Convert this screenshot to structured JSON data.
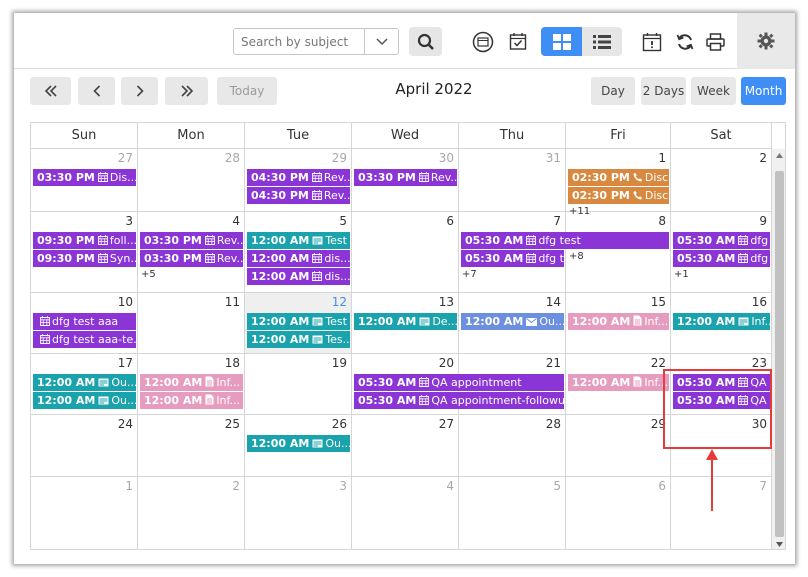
{
  "toolbar": {
    "search_placeholder": "Search by subject"
  },
  "nav": {
    "today_label": "Today",
    "title": "April 2022",
    "views": [
      {
        "label": "Day",
        "active": false
      },
      {
        "label": "2 Days",
        "active": false
      },
      {
        "label": "Week",
        "active": false
      },
      {
        "label": "Month",
        "active": true
      }
    ]
  },
  "weekdays": [
    "Sun",
    "Mon",
    "Tue",
    "Wed",
    "Thu",
    "Fri",
    "Sat"
  ],
  "weeks": [
    {
      "days": [
        {
          "num": "27",
          "muted": true
        },
        {
          "num": "28",
          "muted": true
        },
        {
          "num": "29",
          "muted": true
        },
        {
          "num": "30",
          "muted": true
        },
        {
          "num": "31",
          "muted": true
        },
        {
          "num": "1"
        },
        {
          "num": "2"
        }
      ]
    },
    {
      "days": [
        {
          "num": "3"
        },
        {
          "num": "4"
        },
        {
          "num": "5"
        },
        {
          "num": "6"
        },
        {
          "num": "7"
        },
        {
          "num": "8"
        },
        {
          "num": "9"
        }
      ]
    },
    {
      "days": [
        {
          "num": "10"
        },
        {
          "num": "11"
        },
        {
          "num": "12",
          "today": true
        },
        {
          "num": "13"
        },
        {
          "num": "14"
        },
        {
          "num": "15"
        },
        {
          "num": "16"
        }
      ]
    },
    {
      "days": [
        {
          "num": "17"
        },
        {
          "num": "18"
        },
        {
          "num": "19"
        },
        {
          "num": "20"
        },
        {
          "num": "21"
        },
        {
          "num": "22"
        },
        {
          "num": "23"
        }
      ]
    },
    {
      "days": [
        {
          "num": "24"
        },
        {
          "num": "25"
        },
        {
          "num": "26"
        },
        {
          "num": "27"
        },
        {
          "num": "28"
        },
        {
          "num": "29"
        },
        {
          "num": "30"
        }
      ]
    },
    {
      "days": [
        {
          "num": "1",
          "muted": true
        },
        {
          "num": "2",
          "muted": true
        },
        {
          "num": "3",
          "muted": true
        },
        {
          "num": "4",
          "muted": true
        },
        {
          "num": "5",
          "muted": true
        },
        {
          "num": "6",
          "muted": true
        },
        {
          "num": "7",
          "muted": true
        }
      ]
    }
  ],
  "events": [
    {
      "week": 0,
      "col": 0,
      "span": 1,
      "slot": 0,
      "time": "03:30 PM",
      "icon": "calendar",
      "title": "Dis...",
      "color": "purple"
    },
    {
      "week": 0,
      "col": 2,
      "span": 1,
      "slot": 0,
      "time": "04:30 PM",
      "icon": "calendar",
      "title": "Rev...",
      "color": "purple"
    },
    {
      "week": 0,
      "col": 2,
      "span": 1,
      "slot": 1,
      "time": "04:30 PM",
      "icon": "calendar",
      "title": "Rev...",
      "color": "purple"
    },
    {
      "week": 0,
      "col": 3,
      "span": 1,
      "slot": 0,
      "time": "03:30 PM",
      "icon": "calendar",
      "title": "Rev...",
      "color": "purple"
    },
    {
      "week": 0,
      "col": 5,
      "span": 1,
      "slot": 0,
      "time": "02:30 PM",
      "icon": "phone",
      "title": "Disc...",
      "color": "orange"
    },
    {
      "week": 0,
      "col": 5,
      "span": 1,
      "slot": 1,
      "time": "02:30 PM",
      "icon": "phone",
      "title": "Disc...",
      "color": "orange"
    },
    {
      "week": 1,
      "col": 0,
      "span": 1,
      "slot": 0,
      "time": "09:30 PM",
      "icon": "calendar",
      "title": "foll...",
      "color": "purple"
    },
    {
      "week": 1,
      "col": 0,
      "span": 1,
      "slot": 1,
      "time": "09:30 PM",
      "icon": "calendar",
      "title": "Syn...",
      "color": "purple"
    },
    {
      "week": 1,
      "col": 1,
      "span": 1,
      "slot": 0,
      "time": "03:30 PM",
      "icon": "calendar",
      "title": "Rev...",
      "color": "purple"
    },
    {
      "week": 1,
      "col": 1,
      "span": 1,
      "slot": 1,
      "time": "03:30 PM",
      "icon": "calendar",
      "title": "Rev...",
      "color": "purple"
    },
    {
      "week": 1,
      "col": 2,
      "span": 1,
      "slot": 0,
      "time": "12:00 AM",
      "icon": "card",
      "title": "Test",
      "color": "teal"
    },
    {
      "week": 1,
      "col": 2,
      "span": 1,
      "slot": 1,
      "time": "12:00 AM",
      "icon": "calendar",
      "title": "dis...",
      "color": "purple"
    },
    {
      "week": 1,
      "col": 2,
      "span": 1,
      "slot": 2,
      "time": "12:00 AM",
      "icon": "calendar",
      "title": "dis...",
      "color": "purple"
    },
    {
      "week": 1,
      "col": 4,
      "span": 2,
      "slot": 0,
      "time": "05:30 AM",
      "icon": "calendar",
      "title": "dfg test",
      "color": "purple"
    },
    {
      "week": 1,
      "col": 4,
      "span": 1,
      "slot": 1,
      "time": "05:30 AM",
      "icon": "calendar",
      "title": "dfg test ..",
      "color": "purple"
    },
    {
      "week": 1,
      "col": 6,
      "span": 1,
      "slot": 0,
      "time": "05:30 AM",
      "icon": "calendar",
      "title": "dfg ...",
      "color": "purple"
    },
    {
      "week": 1,
      "col": 6,
      "span": 1,
      "slot": 1,
      "time": "05:30 AM",
      "icon": "calendar",
      "title": "dfg ...",
      "color": "purple"
    },
    {
      "week": 2,
      "col": 0,
      "span": 1,
      "slot": 0,
      "time": "",
      "icon": "calendar",
      "title": "dfg test aaa",
      "color": "purple"
    },
    {
      "week": 2,
      "col": 0,
      "span": 1,
      "slot": 1,
      "time": "",
      "icon": "calendar",
      "title": "dfg test aaa-te...",
      "color": "purple"
    },
    {
      "week": 2,
      "col": 2,
      "span": 1,
      "slot": 0,
      "time": "12:00 AM",
      "icon": "card",
      "title": "Test",
      "color": "teal"
    },
    {
      "week": 2,
      "col": 2,
      "span": 1,
      "slot": 1,
      "time": "12:00 AM",
      "icon": "card",
      "title": "Tes...",
      "color": "teal"
    },
    {
      "week": 2,
      "col": 3,
      "span": 1,
      "slot": 0,
      "time": "12:00 AM",
      "icon": "card",
      "title": "De...",
      "color": "teal"
    },
    {
      "week": 2,
      "col": 4,
      "span": 1,
      "slot": 0,
      "time": "12:00 AM",
      "icon": "mail",
      "title": "Ou...",
      "color": "lblue"
    },
    {
      "week": 2,
      "col": 5,
      "span": 1,
      "slot": 0,
      "time": "12:00 AM",
      "icon": "doc",
      "title": "Inf...",
      "color": "pink"
    },
    {
      "week": 2,
      "col": 6,
      "span": 1,
      "slot": 0,
      "time": "12:00 AM",
      "icon": "card",
      "title": "Inf...",
      "color": "teal"
    },
    {
      "week": 3,
      "col": 0,
      "span": 1,
      "slot": 0,
      "time": "12:00 AM",
      "icon": "card",
      "title": "Ou...",
      "color": "teal"
    },
    {
      "week": 3,
      "col": 0,
      "span": 1,
      "slot": 1,
      "time": "12:00 AM",
      "icon": "card",
      "title": "Ou...",
      "color": "teal"
    },
    {
      "week": 3,
      "col": 1,
      "span": 1,
      "slot": 0,
      "time": "12:00 AM",
      "icon": "doc",
      "title": "Inf...",
      "color": "pink"
    },
    {
      "week": 3,
      "col": 1,
      "span": 1,
      "slot": 1,
      "time": "12:00 AM",
      "icon": "doc",
      "title": "Inf...",
      "color": "pink"
    },
    {
      "week": 3,
      "col": 3,
      "span": 2,
      "slot": 0,
      "time": "05:30 AM",
      "icon": "calendar",
      "title": "QA appointment",
      "color": "purple"
    },
    {
      "week": 3,
      "col": 3,
      "span": 2,
      "slot": 1,
      "time": "05:30 AM",
      "icon": "calendar",
      "title": "QA appointment-followup",
      "color": "purple"
    },
    {
      "week": 3,
      "col": 5,
      "span": 1,
      "slot": 0,
      "time": "12:00 AM",
      "icon": "doc",
      "title": "Inf...",
      "color": "pink"
    },
    {
      "week": 3,
      "col": 6,
      "span": 1,
      "slot": 0,
      "time": "05:30 AM",
      "icon": "calendar",
      "title": "QA ...",
      "color": "purple"
    },
    {
      "week": 3,
      "col": 6,
      "span": 1,
      "slot": 1,
      "time": "05:30 AM",
      "icon": "calendar",
      "title": "QA ...",
      "color": "purple"
    },
    {
      "week": 4,
      "col": 2,
      "span": 1,
      "slot": 0,
      "time": "12:00 AM",
      "icon": "card",
      "title": "Ou...",
      "color": "teal"
    }
  ],
  "more_links": [
    {
      "week": 0,
      "col": 5,
      "label": "+11"
    },
    {
      "week": 1,
      "col": 1,
      "label": "+5"
    },
    {
      "week": 1,
      "col": 4,
      "label": "+7"
    },
    {
      "week": 1,
      "col": 5,
      "label": "+8"
    },
    {
      "week": 1,
      "col": 6,
      "label": "+1"
    }
  ]
}
